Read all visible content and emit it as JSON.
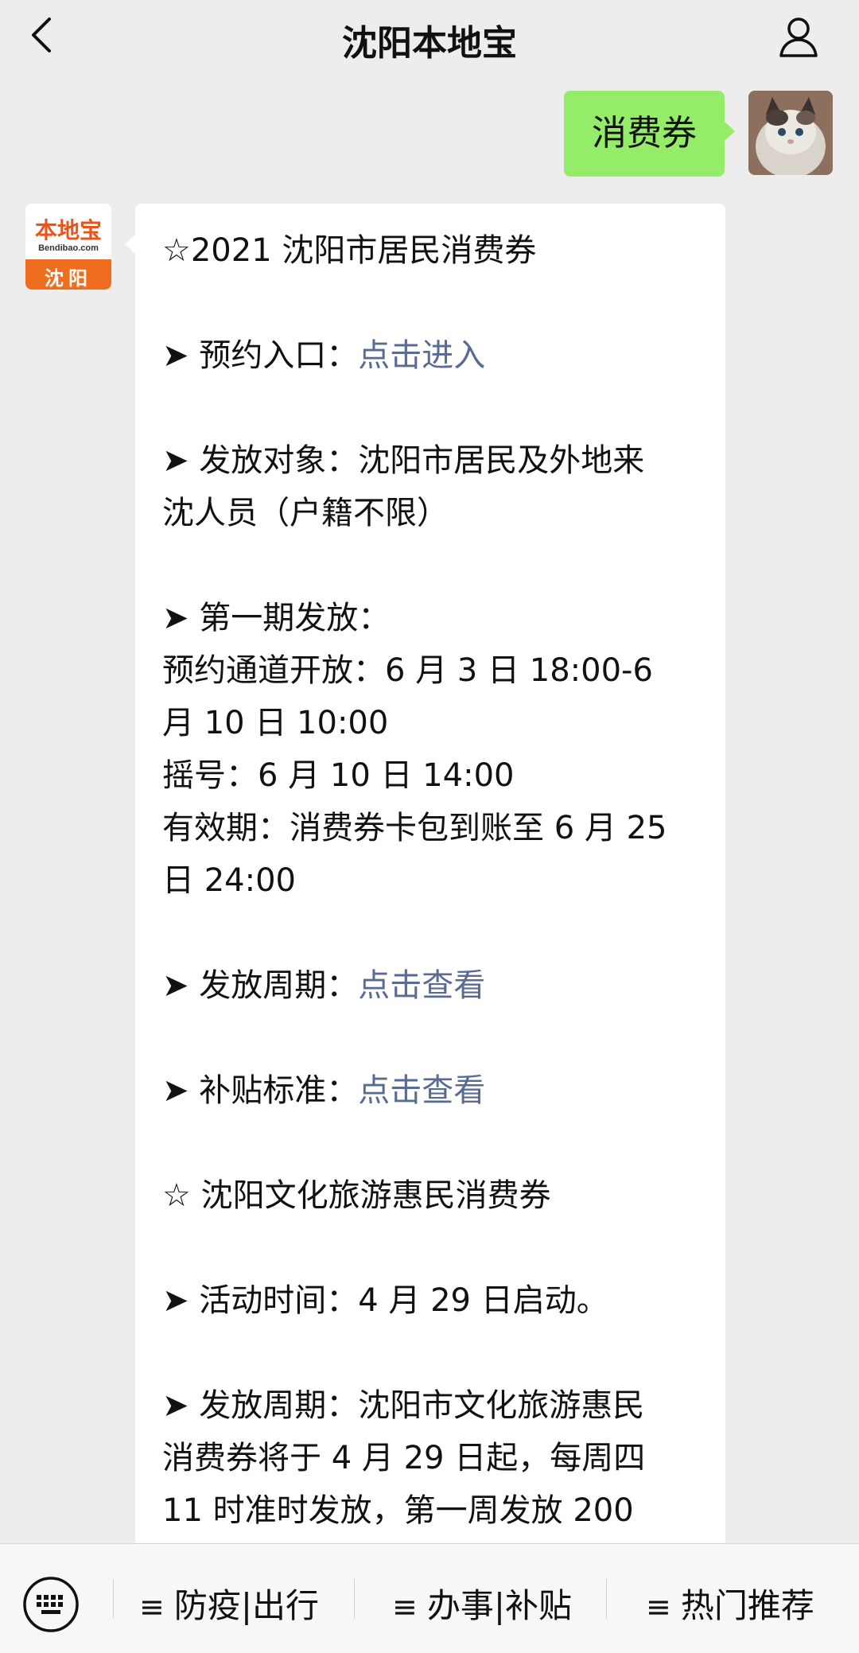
{
  "header": {
    "title": "沈阳本地宝",
    "back_icon": "chevron-left-icon",
    "user_icon": "user-icon"
  },
  "self_message": {
    "text": "消费券"
  },
  "bot_avatar": {
    "brand": "本地宝",
    "domain": "Bendibao.com",
    "city": "沈阳"
  },
  "message": {
    "l01": "☆2021 沈阳市居民消费券",
    "l02_prefix": "➤ 预约入口：",
    "l02_link": "点击进入",
    "l03": "➤ 发放对象：沈阳市居民及外地来",
    "l04": "沈人员（户籍不限）",
    "l05": "➤ 第一期发放：",
    "l06": "预约通道开放：6 月 3 日 18:00-6",
    "l07": "月 10 日 10:00",
    "l08": "摇号：6 月 10 日 14:00",
    "l09": "有效期：消费券卡包到账至 6 月 25",
    "l10": "日 24:00",
    "l11_prefix": "➤ 发放周期：",
    "l11_link": "点击查看",
    "l12_prefix": "➤ 补贴标准：",
    "l12_link": "点击查看",
    "l13": "☆ 沈阳文化旅游惠民消费券",
    "l14": "➤ 活动时间：4 月 29 日启动。",
    "l15": "➤ 发放周期：沈阳市文化旅游惠民",
    "l16": "消费券将于 4 月 29 日起，每周四",
    "l17": "11 时准时发放，第一周发放 200"
  },
  "menu": {
    "keyboard_icon": "keyboard-icon",
    "item1": "防疫|出行",
    "item2": "办事|补贴",
    "item3": "热门推荐",
    "item_icon_glyph": "≡"
  },
  "colors": {
    "background": "#ededed",
    "self_bubble": "#95ec69",
    "link": "#576b95",
    "brand_orange": "#ee6d1f"
  }
}
